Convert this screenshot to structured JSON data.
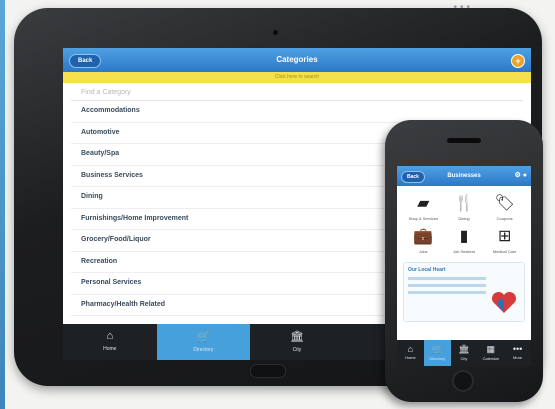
{
  "tablet": {
    "back_label": "Back",
    "title": "Categories",
    "banner": "Click here to search",
    "search_placeholder": "Find a Category",
    "categories": [
      "Accommodations",
      "Automotive",
      "Beauty/Spa",
      "Business Services",
      "Dining",
      "Furnishings/Home Improvement",
      "Grocery/Food/Liquor",
      "Recreation",
      "Personal Services",
      "Pharmacy/Health Related"
    ],
    "tabs": [
      {
        "label": "Home",
        "icon": "home-icon"
      },
      {
        "label": "Directory",
        "icon": "cart-icon"
      },
      {
        "label": "City",
        "icon": "bank-icon"
      },
      {
        "label": "",
        "icon": "none"
      },
      {
        "label": "",
        "icon": "none"
      }
    ]
  },
  "phone": {
    "back_label": "Back",
    "title": "Businesses",
    "grid": [
      {
        "label": "Shop & Services",
        "icon": "map-icon"
      },
      {
        "label": "Dining",
        "icon": "utensils-icon"
      },
      {
        "label": "Coupons",
        "icon": "tag-icon"
      },
      {
        "label": "Jobs",
        "icon": "briefcase-icon"
      },
      {
        "label": "Job Seekers",
        "icon": "document-icon"
      },
      {
        "label": "Medical Care",
        "icon": "plus-icon"
      }
    ],
    "card_title": "Our Local Heart",
    "tabs": [
      {
        "label": "Home",
        "icon": "home-icon"
      },
      {
        "label": "Directory",
        "icon": "cart-icon"
      },
      {
        "label": "City",
        "icon": "bank-icon"
      },
      {
        "label": "Calendar",
        "icon": "calendar-icon"
      },
      {
        "label": "More",
        "icon": "more-icon"
      }
    ]
  },
  "colors": {
    "accent": "#45a0db",
    "header": "#2c78c8",
    "banner": "#f4e04a",
    "bezel": "#1c1d1f"
  }
}
